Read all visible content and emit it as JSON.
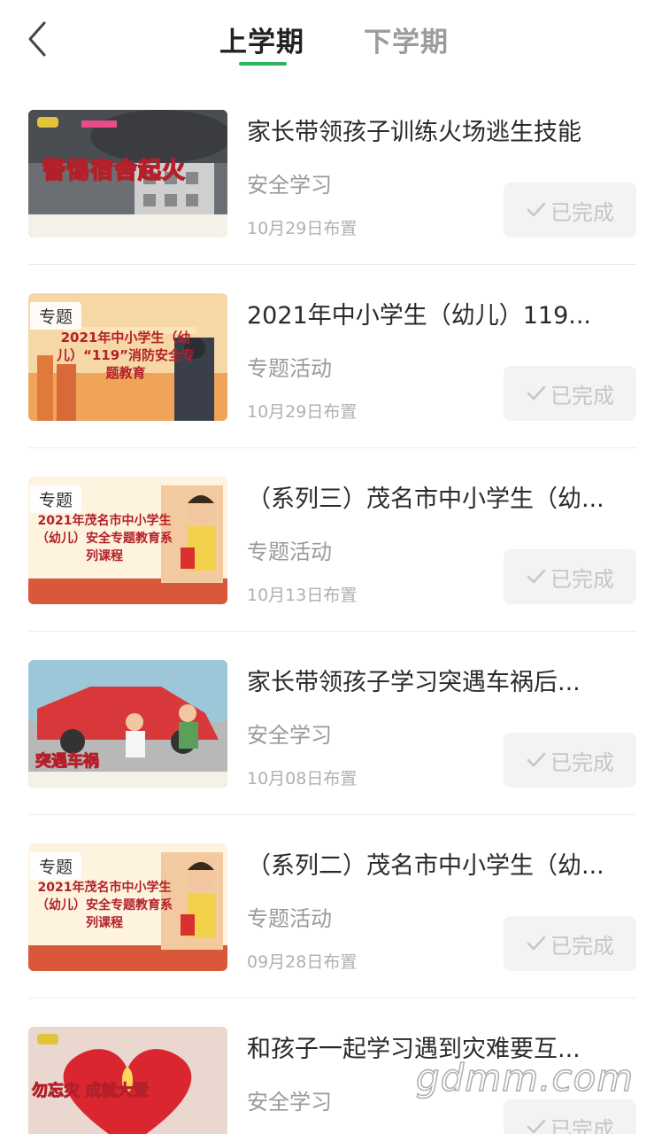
{
  "header": {
    "tabs": [
      {
        "label": "上学期",
        "active": true
      },
      {
        "label": "下学期",
        "active": false
      }
    ],
    "accent_color": "#2db55d"
  },
  "items": [
    {
      "title": "家长带领孩子训练火场逃生技能",
      "category": "安全学习",
      "date": "10月29日布置",
      "status": "已完成",
      "tag": "",
      "thumb_text": "警惕宿舍起火",
      "thumb_icon": "fire-building-thumbnail"
    },
    {
      "title": "2021年中小学生（幼儿）119...",
      "category": "专题活动",
      "date": "10月29日布置",
      "status": "已完成",
      "tag": "专题",
      "thumb_text": "2021年中小学生（幼儿）“119”消防安全专题教育",
      "thumb_icon": "firefighter-poster-thumbnail"
    },
    {
      "title": "（系列三）茂名市中小学生（幼...",
      "category": "专题活动",
      "date": "10月13日布置",
      "status": "已完成",
      "tag": "专题",
      "thumb_text": "2021年茂名市中小学生（幼儿）安全专题教育系列课程",
      "thumb_icon": "student-poster-thumbnail"
    },
    {
      "title": "家长带领孩子学习突遇车祸后...",
      "category": "安全学习",
      "date": "10月08日布置",
      "status": "已完成",
      "tag": "",
      "thumb_text": "突遇车祸",
      "thumb_icon": "car-accident-thumbnail"
    },
    {
      "title": "（系列二）茂名市中小学生（幼...",
      "category": "专题活动",
      "date": "09月28日布置",
      "status": "已完成",
      "tag": "专题",
      "thumb_text": "2021年茂名市中小学生（幼儿）安全专题教育系列课程",
      "thumb_icon": "student-poster-thumbnail"
    },
    {
      "title": "和孩子一起学习遇到灾难要互...",
      "category": "安全学习",
      "date": "",
      "status": "已完成",
      "tag": "",
      "thumb_text": "勿忘灾 成就大爱",
      "thumb_icon": "heart-candle-thumbnail"
    }
  ],
  "watermark": "gdmm.com"
}
